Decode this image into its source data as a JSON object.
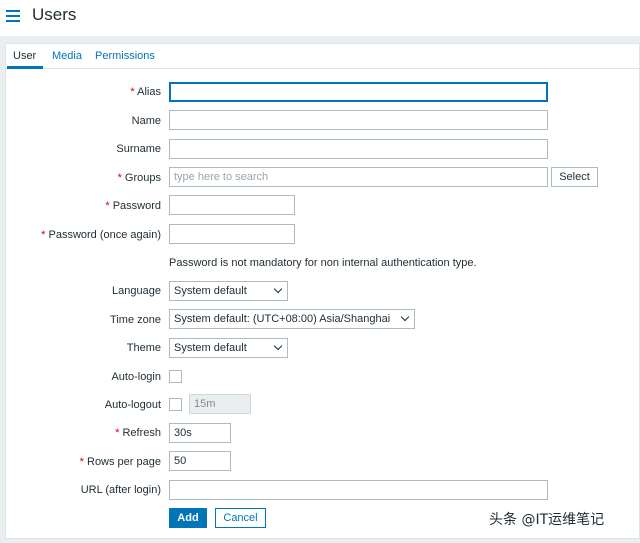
{
  "header": {
    "title": "Users"
  },
  "tabs": [
    {
      "label": "User",
      "active": true
    },
    {
      "label": "Media",
      "active": false
    },
    {
      "label": "Permissions",
      "active": false
    }
  ],
  "form": {
    "alias_label": "Alias",
    "name_label": "Name",
    "surname_label": "Surname",
    "groups_label": "Groups",
    "groups_placeholder": "type here to search",
    "select_button": "Select",
    "password_label": "Password",
    "password_again_label": "Password (once again)",
    "password_hint": "Password is not mandatory for non internal authentication type.",
    "language_label": "Language",
    "language_value": "System default",
    "timezone_label": "Time zone",
    "timezone_value": "System default: (UTC+08:00) Asia/Shanghai",
    "theme_label": "Theme",
    "theme_value": "System default",
    "autologin_label": "Auto-login",
    "autologout_label": "Auto-logout",
    "autologout_value": "15m",
    "refresh_label": "Refresh",
    "refresh_value": "30s",
    "rows_label": "Rows per page",
    "rows_value": "50",
    "url_label": "URL (after login)",
    "add_button": "Add",
    "cancel_button": "Cancel"
  },
  "watermark": "头条 @IT运维笔记",
  "colors": {
    "accent": "#0275b8",
    "required": "#d40000",
    "background": "#ebeef0"
  }
}
